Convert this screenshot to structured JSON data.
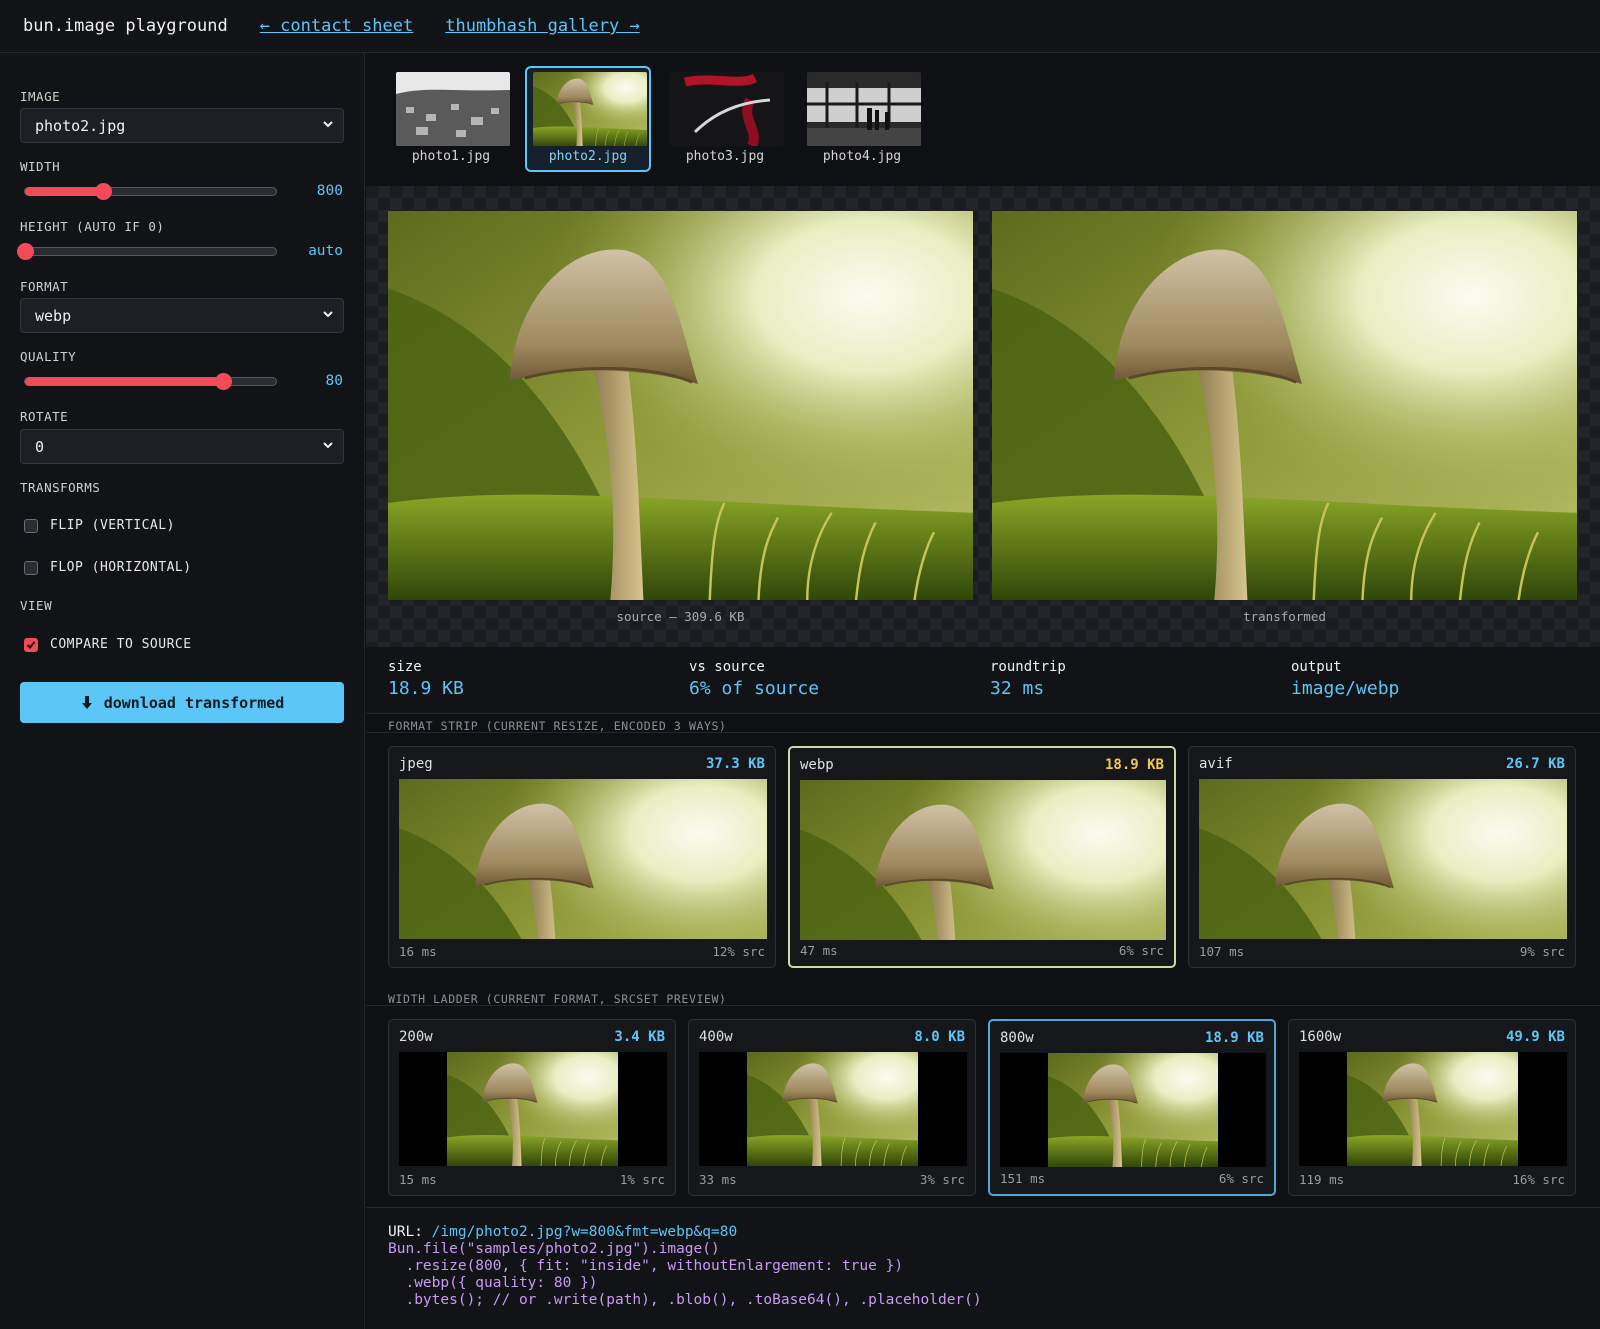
{
  "header": {
    "title": "bun.image playground",
    "link_contact": "← contact sheet",
    "link_gallery": "thumbhash gallery →"
  },
  "sidebar": {
    "image": {
      "label": "IMAGE",
      "value": "photo2.jpg"
    },
    "width": {
      "label": "WIDTH",
      "value": "800",
      "fraction": 0.31
    },
    "height": {
      "label": "HEIGHT (AUTO IF 0)",
      "value": "auto",
      "fraction": 0.0
    },
    "format": {
      "label": "FORMAT",
      "value": "webp"
    },
    "quality": {
      "label": "QUALITY",
      "value": "80",
      "fraction": 0.79
    },
    "rotate": {
      "label": "ROTATE",
      "value": "0"
    },
    "transforms": {
      "label": "TRANSFORMS",
      "flip": {
        "label": "FLIP (VERTICAL)",
        "checked": false
      },
      "flop": {
        "label": "FLOP (HORIZONTAL)",
        "checked": false
      }
    },
    "view": {
      "label": "VIEW",
      "compare": {
        "label": "COMPARE TO SOURCE",
        "checked": true
      }
    },
    "download_label": "download transformed"
  },
  "thumbnails": [
    {
      "name": "photo1.jpg",
      "active": false
    },
    {
      "name": "photo2.jpg",
      "active": true
    },
    {
      "name": "photo3.jpg",
      "active": false
    },
    {
      "name": "photo4.jpg",
      "active": false
    }
  ],
  "compare": {
    "source_caption": "source — 309.6 KB",
    "transformed_caption": "transformed"
  },
  "stats": [
    {
      "key": "size",
      "value": "18.9 KB"
    },
    {
      "key": "vs source",
      "value": "6% of source"
    },
    {
      "key": "roundtrip",
      "value": "32 ms"
    },
    {
      "key": "output",
      "value": "image/webp"
    }
  ],
  "format_strip": {
    "label": "FORMAT STRIP (CURRENT RESIZE, ENCODED 3 WAYS)",
    "items": [
      {
        "format": "jpeg",
        "size": "37.3 KB",
        "time": "16 ms",
        "ratio": "12% src",
        "selected": false
      },
      {
        "format": "webp",
        "size": "18.9 KB",
        "time": "47 ms",
        "ratio": "6% src",
        "selected": true
      },
      {
        "format": "avif",
        "size": "26.7 KB",
        "time": "107 ms",
        "ratio": "9% src",
        "selected": false
      }
    ]
  },
  "width_ladder": {
    "label": "WIDTH LADDER (CURRENT FORMAT, SRCSET PREVIEW)",
    "items": [
      {
        "width": "200w",
        "size": "3.4 KB",
        "time": "15 ms",
        "ratio": "1% src",
        "selected": false
      },
      {
        "width": "400w",
        "size": "8.0 KB",
        "time": "33 ms",
        "ratio": "3% src",
        "selected": false
      },
      {
        "width": "800w",
        "size": "18.9 KB",
        "time": "151 ms",
        "ratio": "6% src",
        "selected": true
      },
      {
        "width": "1600w",
        "size": "49.9 KB",
        "time": "119 ms",
        "ratio": "16% src",
        "selected": false
      }
    ]
  },
  "code": {
    "url_key": "URL:",
    "url_value": "/img/photo2.jpg?w=800&fmt=webp&q=80",
    "lines": [
      "Bun.file(\"samples/photo2.jpg\").image()",
      "  .resize(800, { fit: \"inside\", withoutEnlargement: true })",
      "  .webp({ quality: 80 })",
      "  .bytes(); // or .write(path), .blob(), .toBase64(), .placeholder()"
    ]
  },
  "colors": {
    "accent": "#5cc6f6",
    "slider": "#f04b57",
    "selected_size": "#f2c84b"
  }
}
